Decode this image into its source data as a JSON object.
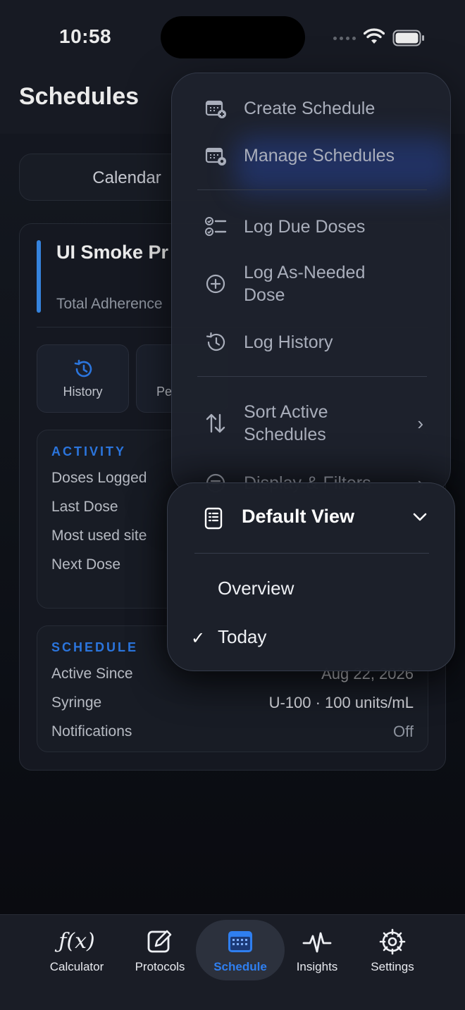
{
  "status_bar": {
    "time": "10:58"
  },
  "header": {
    "title": "Schedules"
  },
  "segment": {
    "left_label": "Calendar"
  },
  "card": {
    "title": "UI Smoke Pr",
    "subtitle": "Total Adherence",
    "tiles": [
      {
        "label": "History",
        "icon": "history-icon"
      },
      {
        "label": "Pe",
        "icon": ""
      }
    ],
    "activity": {
      "heading": "ACTIVITY",
      "rows": [
        {
          "label": "Doses Logged"
        },
        {
          "label": "Last Dose"
        },
        {
          "label": "Most used site"
        },
        {
          "label": "Next Dose"
        }
      ]
    },
    "schedule": {
      "heading": "SCHEDULE",
      "rows": [
        {
          "label": "Active Since",
          "value": "Aug 22, 2026"
        },
        {
          "label": "Syringe",
          "value": "U-100 · 100 units/mL"
        },
        {
          "label": "Notifications",
          "value": "Off"
        }
      ]
    }
  },
  "menu": {
    "items": [
      {
        "label": "Create Schedule",
        "icon": "calendar-plus-icon"
      },
      {
        "label": "Manage Schedules",
        "icon": "calendar-gear-icon"
      },
      {
        "label": "Log Due Doses",
        "icon": "checklist-icon"
      },
      {
        "label": "Log As-Needed Dose",
        "icon": "plus-circle-icon"
      },
      {
        "label": "Log History",
        "icon": "history-icon"
      },
      {
        "label": "Sort Active Schedules",
        "icon": "sort-arrows-icon"
      },
      {
        "label": "Display & Filters",
        "icon": "filter-circle-icon"
      }
    ]
  },
  "submenu": {
    "title": "Default View",
    "icon": "document-list-icon",
    "options": [
      {
        "label": "Overview",
        "selected": false
      },
      {
        "label": "Today",
        "selected": true
      }
    ],
    "check_glyph": "✓"
  },
  "tabbar": {
    "tabs": [
      {
        "label": "Calculator",
        "icon": "function-icon"
      },
      {
        "label": "Protocols",
        "icon": "edit-square-icon"
      },
      {
        "label": "Schedule",
        "icon": "calendar-grid-icon",
        "active": true
      },
      {
        "label": "Insights",
        "icon": "pulse-icon"
      },
      {
        "label": "Settings",
        "icon": "gear-icon"
      }
    ],
    "function_glyph": "ƒ(x)"
  },
  "colors": {
    "accent": "#2f7ff0",
    "background": "#0b0d12",
    "surface": "#1b1f29"
  }
}
